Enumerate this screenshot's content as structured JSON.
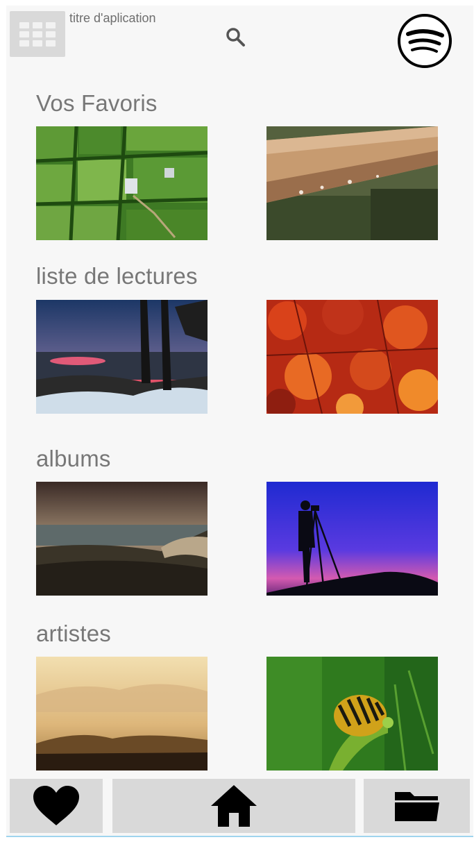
{
  "header": {
    "app_title": "titre d'aplication",
    "menu_icon": "grid-menu-icon",
    "search_icon": "search-icon",
    "brand_icon": "spotify-logo-icon"
  },
  "sections": [
    {
      "title": "Vos Favoris",
      "images": [
        "aerial-farm-fields-photo",
        "wooden-rail-raindrops-photo"
      ]
    },
    {
      "title": "liste de lectures",
      "images": [
        "lake-sunset-snow-photo",
        "red-maple-leaves-photo"
      ]
    },
    {
      "title": "albums",
      "images": [
        "coastal-cliffs-photo",
        "photographer-silhouette-photo"
      ]
    },
    {
      "title": "artistes",
      "images": [
        "desert-dunes-haze-photo",
        "caterpillar-green-photo"
      ]
    }
  ],
  "bottom_nav": {
    "favorites_icon": "heart-icon",
    "home_icon": "home-icon",
    "files_icon": "folder-icon"
  },
  "colors": {
    "background": "#f7f7f7",
    "button_gray": "#d9d9d9",
    "title_gray": "#777777",
    "icon_black": "#000000"
  }
}
